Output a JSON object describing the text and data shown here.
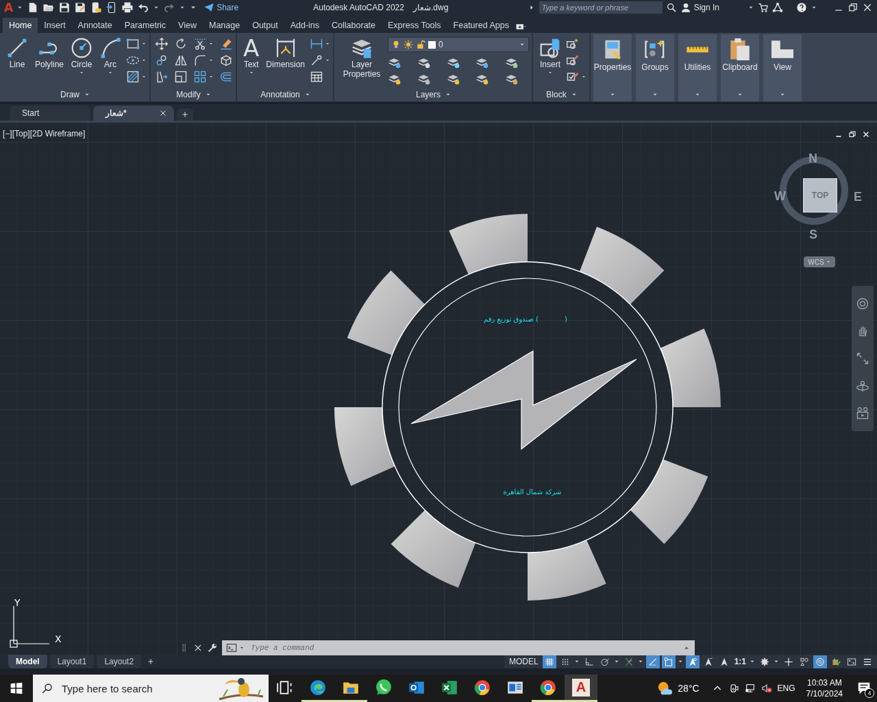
{
  "title_bar": {
    "logo": "A",
    "share": "Share",
    "app_title": "Autodesk AutoCAD 2022",
    "file_name": "شعار.dwg",
    "search": {
      "placeholder": "Type a keyword or phrase"
    },
    "sign_in": "Sign In"
  },
  "ribbon_tabs": [
    {
      "label": "Home",
      "selected": true
    },
    {
      "label": "Insert",
      "selected": false
    },
    {
      "label": "Annotate",
      "selected": false
    },
    {
      "label": "Parametric",
      "selected": false
    },
    {
      "label": "View",
      "selected": false
    },
    {
      "label": "Manage",
      "selected": false
    },
    {
      "label": "Output",
      "selected": false
    },
    {
      "label": "Add-ins",
      "selected": false
    },
    {
      "label": "Collaborate",
      "selected": false
    },
    {
      "label": "Express Tools",
      "selected": false
    },
    {
      "label": "Featured Apps",
      "selected": false
    }
  ],
  "ribbon_panels": [
    {
      "kind": "draw",
      "title": "Draw",
      "tools": [
        {
          "label": "Line",
          "menu": false
        },
        {
          "label": "Polyline",
          "menu": false
        },
        {
          "label": "Circle",
          "menu": true
        },
        {
          "label": "Arc",
          "menu": true
        }
      ],
      "small_tools": [
        {
          "menu": true
        },
        {
          "menu": true
        },
        {
          "menu": true
        }
      ]
    },
    {
      "kind": "modify",
      "title": "Modify",
      "small_tools": [
        {
          "menu": false
        },
        {
          "menu": false
        },
        {
          "menu": true
        },
        {
          "menu": false
        },
        {
          "menu": false
        },
        {
          "menu": false
        },
        {
          "menu": true
        },
        {
          "menu": false
        },
        {
          "menu": false
        },
        {
          "menu": false
        },
        {
          "menu": true
        },
        {
          "menu": false
        }
      ]
    },
    {
      "kind": "annotation",
      "title": "Annotation",
      "tools": [
        {
          "label": "Text",
          "glyph": "A",
          "menu": true
        },
        {
          "label": "Dimension",
          "menu": false
        }
      ],
      "small_tools": [
        {
          "menu": true
        },
        {
          "menu": true
        },
        {
          "menu": false
        }
      ]
    },
    {
      "kind": "layers",
      "title": "Layers",
      "tools": [
        {
          "label": "Layer Properties",
          "menu": false
        }
      ],
      "layer": {
        "value": "0"
      },
      "small_tools": [
        {
          "menu": false
        },
        {
          "menu": false
        },
        {
          "menu": false
        },
        {
          "menu": false
        },
        {
          "menu": false
        },
        {
          "menu": false
        },
        {
          "menu": false
        },
        {
          "menu": false
        },
        {
          "menu": false
        },
        {
          "menu": false
        }
      ]
    },
    {
      "kind": "block",
      "title": "Block",
      "tools": [
        {
          "label": "Insert",
          "menu": true
        }
      ],
      "small_tools": [
        {
          "menu": false
        },
        {
          "menu": false
        },
        {
          "menu": true
        }
      ]
    },
    {
      "kind": "properties",
      "title": "Properties"
    },
    {
      "kind": "groups",
      "title": "Groups"
    },
    {
      "kind": "utilities",
      "title": "Utilities"
    },
    {
      "kind": "clipboard",
      "title": "Clipboard"
    },
    {
      "kind": "view",
      "title": "View"
    }
  ],
  "file_tabs": [
    {
      "label": "Start",
      "selected": false,
      "closable": false
    },
    {
      "label": "شعار*",
      "selected": true,
      "closable": true
    }
  ],
  "viewport_label": "[−][Top][2D Wireframe]",
  "view_cube": {
    "north": "N",
    "west": "W",
    "east": "E",
    "south": "S",
    "face": "TOP",
    "ucs": "WCS"
  },
  "drawing": {
    "top_text": "صندوق توزيع رقم (            )",
    "bottom_text": "شركة شمال القاهرة"
  },
  "ucs": {
    "y": "Y",
    "x": "X"
  },
  "command_line": {
    "placeholder": "Type a command"
  },
  "layout_tabs": [
    {
      "label": "Model",
      "selected": true
    },
    {
      "label": "Layout1",
      "selected": false
    },
    {
      "label": "Layout2",
      "selected": false
    }
  ],
  "status_bar": {
    "model": "MODEL",
    "items": [
      {
        "kind": "grid",
        "on": true,
        "menu": false
      },
      {
        "kind": "snap",
        "on": false,
        "menu": true
      },
      {
        "kind": "ortho",
        "on": false,
        "menu": false
      },
      {
        "kind": "polar",
        "on": false,
        "menu": true
      },
      {
        "kind": "isodraft",
        "on": false,
        "menu": true
      },
      {
        "kind": "tracking",
        "on": true,
        "menu": false
      },
      {
        "kind": "object-snap",
        "on": true,
        "menu": true
      },
      {
        "kind": "annotation-visibility",
        "on": true,
        "menu": false
      },
      {
        "kind": "auto-scale",
        "on": false,
        "menu": false
      },
      {
        "kind": "annotation-scale",
        "on": false,
        "menu": false
      },
      {
        "kind": "scale",
        "label": "1:1",
        "menu": true
      },
      {
        "kind": "workspace",
        "on": false,
        "menu": true
      },
      {
        "kind": "annotation-monitor",
        "on": false,
        "menu": false
      },
      {
        "kind": "units",
        "on": false,
        "menu": false
      },
      {
        "kind": "isolate",
        "on": true,
        "menu": false
      },
      {
        "kind": "hardware",
        "on": false,
        "menu": false
      },
      {
        "kind": "clean-screen",
        "on": false,
        "menu": false
      },
      {
        "kind": "customize",
        "on": false,
        "menu": false
      }
    ]
  },
  "taskbar": {
    "search": {
      "placeholder": "Type here to search"
    },
    "apps": [
      {
        "kind": "task-view",
        "running": false,
        "active": false
      },
      {
        "kind": "edge",
        "running": true,
        "active": false
      },
      {
        "kind": "file-explorer",
        "running": true,
        "active": false
      },
      {
        "kind": "whatsapp",
        "running": false,
        "active": false
      },
      {
        "kind": "outlook",
        "running": false,
        "active": false
      },
      {
        "kind": "excel",
        "running": false,
        "active": false
      },
      {
        "kind": "chrome",
        "running": false,
        "active": false
      },
      {
        "kind": "window-app",
        "running": false,
        "active": false
      },
      {
        "kind": "chrome",
        "running": true,
        "active": false
      },
      {
        "kind": "autocad",
        "running": true,
        "active": true,
        "glyph": "A"
      }
    ],
    "temperature": "28°C",
    "language": "ENG",
    "time": "10:03 AM",
    "date": "7/10/2024",
    "notifications": "4"
  }
}
